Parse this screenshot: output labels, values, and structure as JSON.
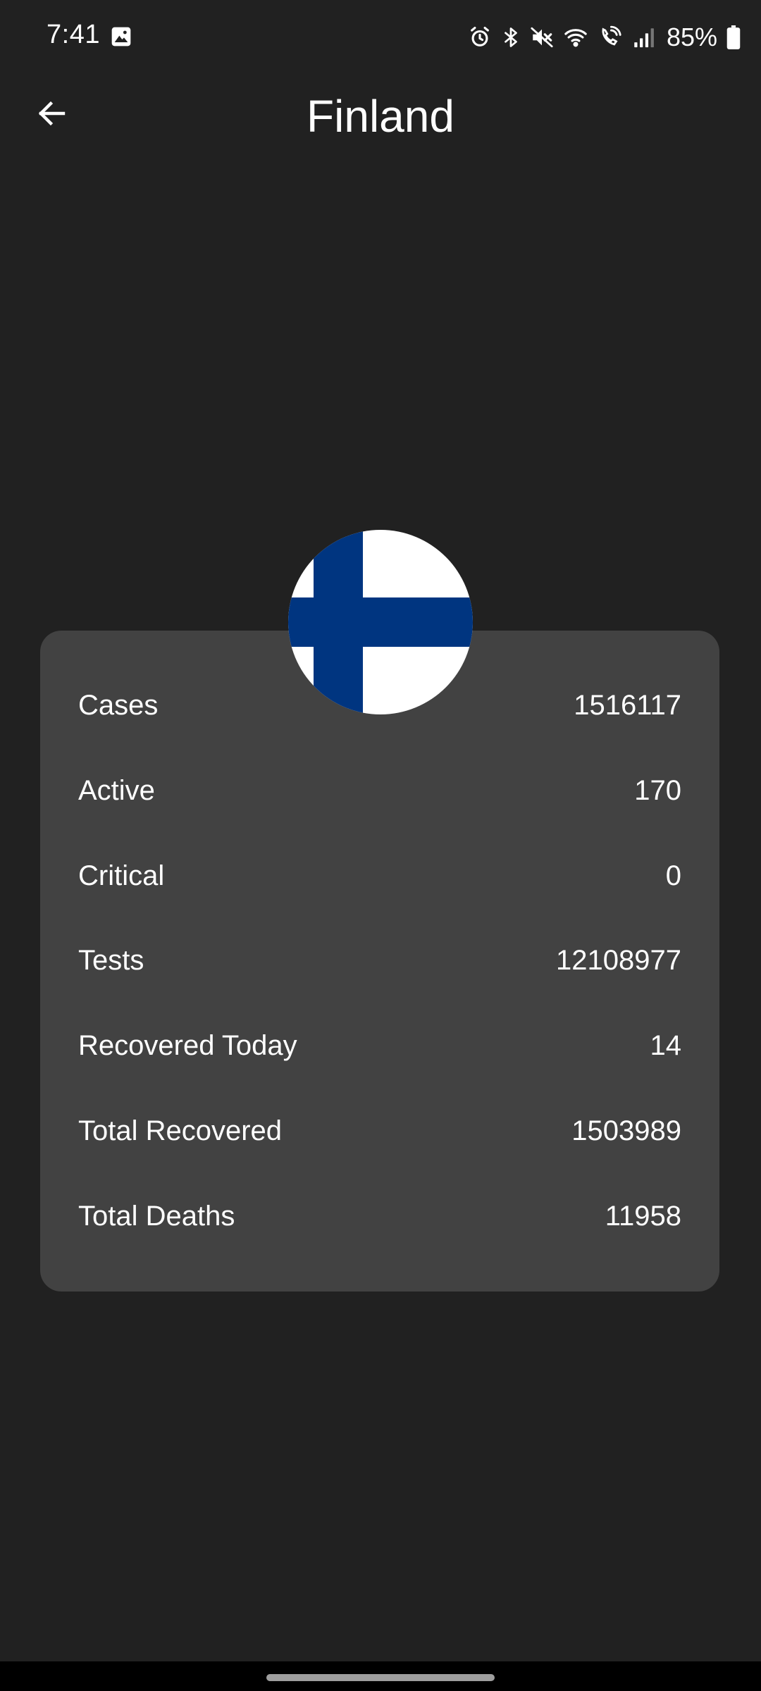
{
  "status_bar": {
    "time": "7:41",
    "battery": "85%",
    "icons": [
      "gallery-icon",
      "alarm-icon",
      "bluetooth-icon",
      "mute-icon",
      "wifi-icon",
      "wifi-calling-icon",
      "signal-icon",
      "battery-icon"
    ]
  },
  "app_bar": {
    "title": "Finland",
    "back_icon": "arrow-back-icon"
  },
  "flag": {
    "country": "Finland",
    "colors": {
      "field": "#ffffff",
      "cross": "#003580"
    }
  },
  "stats": [
    {
      "label": "Cases",
      "value": "1516117"
    },
    {
      "label": "Active",
      "value": "170"
    },
    {
      "label": "Critical",
      "value": "0"
    },
    {
      "label": "Tests",
      "value": "12108977"
    },
    {
      "label": "Recovered Today",
      "value": "14"
    },
    {
      "label": "Total Recovered",
      "value": "1503989"
    },
    {
      "label": "Total Deaths",
      "value": "11958"
    }
  ],
  "colors": {
    "background": "#212121",
    "card": "#424242",
    "text": "#ffffff"
  }
}
